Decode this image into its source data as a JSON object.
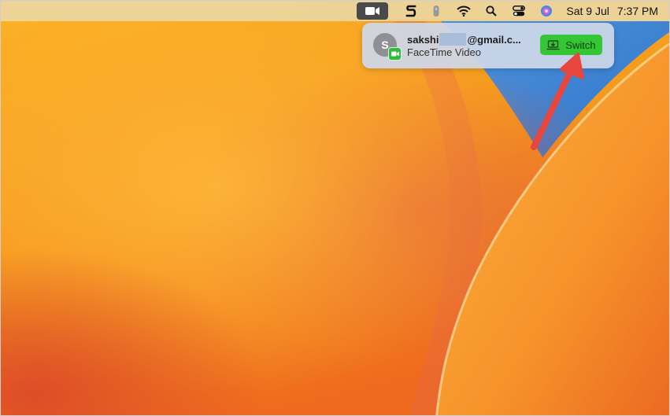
{
  "menubar": {
    "facetime_icon": "video-camera",
    "app_icon": "s-logo",
    "icons": [
      "battery-icon",
      "wifi-icon",
      "search-icon",
      "control-center-icon",
      "siri-icon"
    ],
    "date": "Sat 9 Jul",
    "time": "7:37 PM"
  },
  "notification": {
    "avatar_letter": "S",
    "caller_prefix": "sakshi",
    "caller_suffix": "@gmail.c...",
    "subtitle": "FaceTime Video",
    "switch_label": "Switch"
  },
  "colors": {
    "switch_green": "#34c635",
    "arrow_red": "#e8453c",
    "wallpaper_orange": "#f59a1c",
    "wallpaper_blue": "#3b87d4"
  }
}
